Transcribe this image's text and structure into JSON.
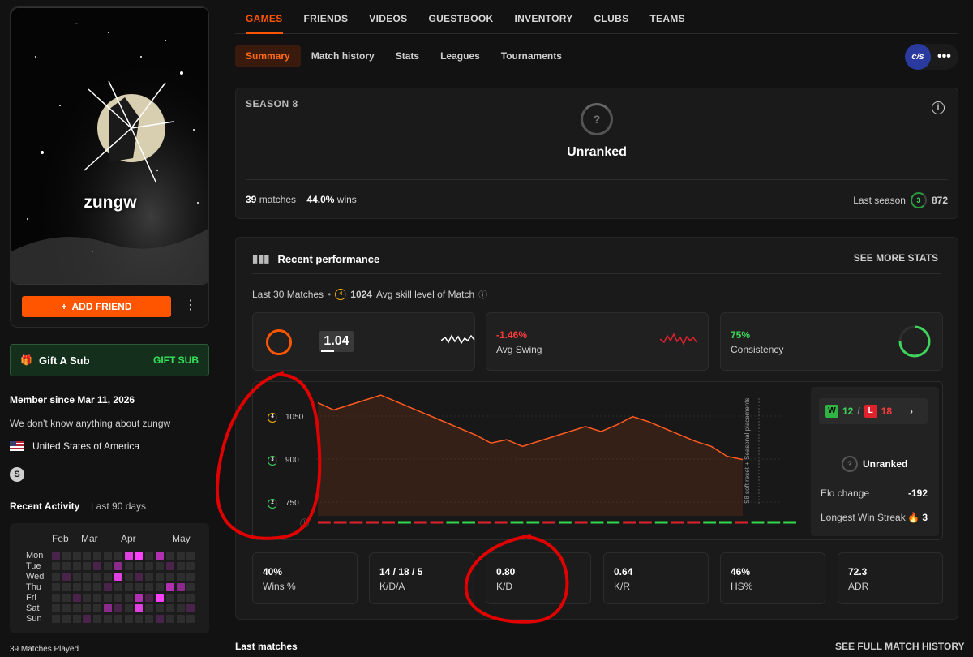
{
  "profile": {
    "username": "zungw",
    "add_friend_label": "ADD FRIEND",
    "more_label": "⋮",
    "gift_label": "Gift A Sub",
    "gift_button": "GIFT SUB",
    "member_since": "Member since Mar 11, 2026",
    "about": "We don't know anything about zungw",
    "country": "United States of America",
    "activity_title": "Recent Activity",
    "activity_range": "Last 90 days",
    "months": [
      "Feb",
      "Mar",
      "Apr",
      "May"
    ],
    "days": [
      "Mon",
      "Tue",
      "Wed",
      "Thu",
      "Fri",
      "Sat",
      "Sun"
    ],
    "matches_played": "39 Matches Played"
  },
  "nav": {
    "tabs": [
      "GAMES",
      "FRIENDS",
      "VIDEOS",
      "GUESTBOOK",
      "INVENTORY",
      "CLUBS",
      "TEAMS"
    ],
    "subtabs": [
      "Summary",
      "Match history",
      "Stats",
      "Leagues",
      "Tournaments"
    ],
    "team_logo": "c/s",
    "team_more": "•••"
  },
  "season": {
    "title": "SEASON 8",
    "rank_icon": "?",
    "rank": "Unranked",
    "matches": "39",
    "matches_label": "matches",
    "wins": "44.0%",
    "wins_label": "wins",
    "last_season_label": "Last season",
    "last_season_level": "3",
    "last_season_elo": "872"
  },
  "performance": {
    "title": "Recent performance",
    "see_more": "SEE MORE STATS",
    "subtitle_prefix": "Last 30 Matches",
    "level": "4",
    "avg_skill": "1024",
    "avg_skill_label": "Avg skill level of Match",
    "rating": "1.04",
    "avg_swing": "-1.46%",
    "avg_swing_label": "Avg Swing",
    "consistency": "75%",
    "consistency_label": "Consistency",
    "consistency_fraction": 0.75,
    "wins_count": "12",
    "losses_count": "18",
    "w": "W",
    "l": "L",
    "side_rank_icon": "?",
    "side_rank": "Unranked",
    "elo_change_label": "Elo change",
    "elo_change": "-192",
    "win_streak_label": "Longest Win Streak",
    "win_streak": "3",
    "reset_note": "S8 soft reset + Seasonal placements",
    "stats": [
      {
        "value": "40%",
        "label": "Wins %"
      },
      {
        "value": "14 / 18 / 5",
        "label": "K/D/A"
      },
      {
        "value": "0.80",
        "label": "K/D"
      },
      {
        "value": "0.64",
        "label": "K/R"
      },
      {
        "value": "46%",
        "label": "HS%"
      },
      {
        "value": "72.3",
        "label": "ADR"
      }
    ]
  },
  "chart_data": {
    "type": "area",
    "y_ticks": [
      {
        "value": 1050,
        "label": "1050",
        "level": "4",
        "color": "#f5b10a"
      },
      {
        "value": 900,
        "label": "900",
        "level": "3",
        "color": "#3fd45b"
      },
      {
        "value": 750,
        "label": "750",
        "level": "2",
        "color": "#3fd45b"
      }
    ],
    "ylim": [
      720,
      1100
    ],
    "elo": [
      1062,
      1040,
      1055,
      1070,
      1085,
      1065,
      1045,
      1025,
      1005,
      985,
      965,
      940,
      950,
      930,
      945,
      960,
      975,
      990,
      975,
      995,
      1020,
      1005,
      985,
      965,
      945,
      930,
      900,
      890
    ],
    "results": [
      "L",
      "L",
      "L",
      "L",
      "L",
      "W",
      "L",
      "L",
      "W",
      "W",
      "L",
      "L",
      "W",
      "W",
      "L",
      "W",
      "L",
      "W",
      "W",
      "L",
      "L",
      "W",
      "L",
      "L",
      "W",
      "W",
      "L",
      "W",
      "W",
      "W"
    ],
    "colors": {
      "line": "#ff5a1f",
      "win": "#2fd94a",
      "loss": "#e0222c"
    }
  },
  "footer": {
    "last_matches": "Last matches",
    "full_history": "SEE FULL MATCH HISTORY"
  }
}
